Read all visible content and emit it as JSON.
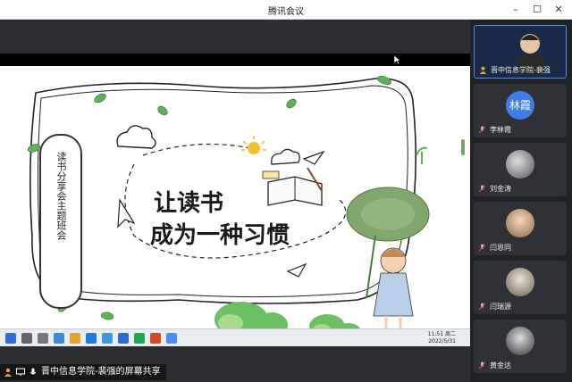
{
  "window": {
    "title": "腾讯会议",
    "minimize": "–",
    "maximize": "☐",
    "close": "✕"
  },
  "slide": {
    "headline_top": "让读书",
    "headline_bottom": "成为一种习惯",
    "vertical_title": "读书分享会主题班会"
  },
  "taskbar": {
    "time": "11:51",
    "weekday": "周二",
    "date": "2022/5/31"
  },
  "share": {
    "label": "晋中信息学院-裴强的屏幕共享"
  },
  "participants": [
    {
      "name": "晋中信息学院-裴强",
      "avatar_text": ""
    },
    {
      "name": "李林霞",
      "avatar_text": "林霞"
    },
    {
      "name": "刘金涛",
      "avatar_text": ""
    },
    {
      "name": "闫恩同",
      "avatar_text": ""
    },
    {
      "name": "闫瑞源",
      "avatar_text": ""
    },
    {
      "name": "黄金达",
      "avatar_text": ""
    }
  ],
  "colors": {
    "accent": "#4c8cf5",
    "leaf_green": "#5bb35a",
    "sun": "#f2c230",
    "ink": "#1a1a1a"
  }
}
